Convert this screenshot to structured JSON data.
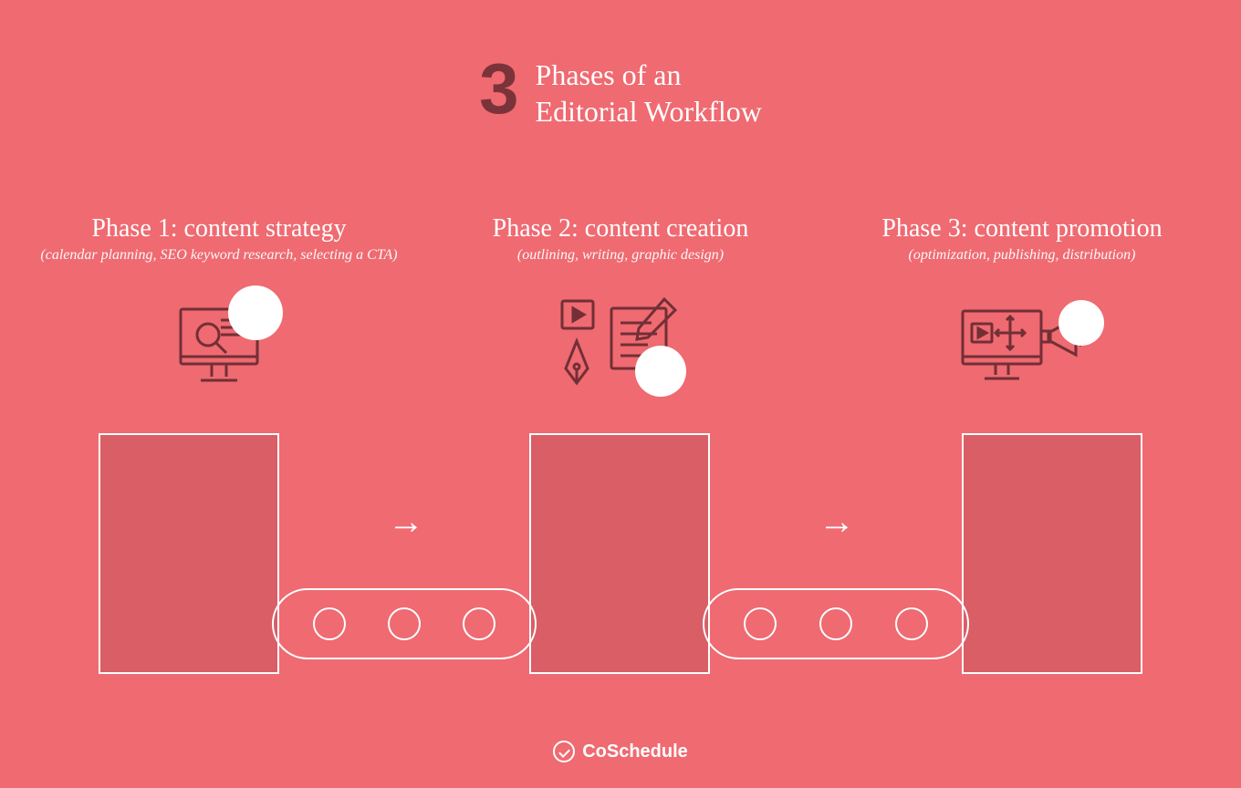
{
  "header": {
    "number": "3",
    "title_line1": "Phases of an",
    "title_line2": "Editorial Workflow"
  },
  "phases": [
    {
      "title": "Phase 1: content strategy",
      "subtitle": "(calendar planning, SEO keyword research, selecting a CTA)"
    },
    {
      "title": "Phase 2: content creation",
      "subtitle": "(outlining, writing, graphic design)"
    },
    {
      "title": "Phase 3: content promotion",
      "subtitle": "(optimization, publishing, distribution)"
    }
  ],
  "footer": {
    "brand": "CoSchedule"
  }
}
